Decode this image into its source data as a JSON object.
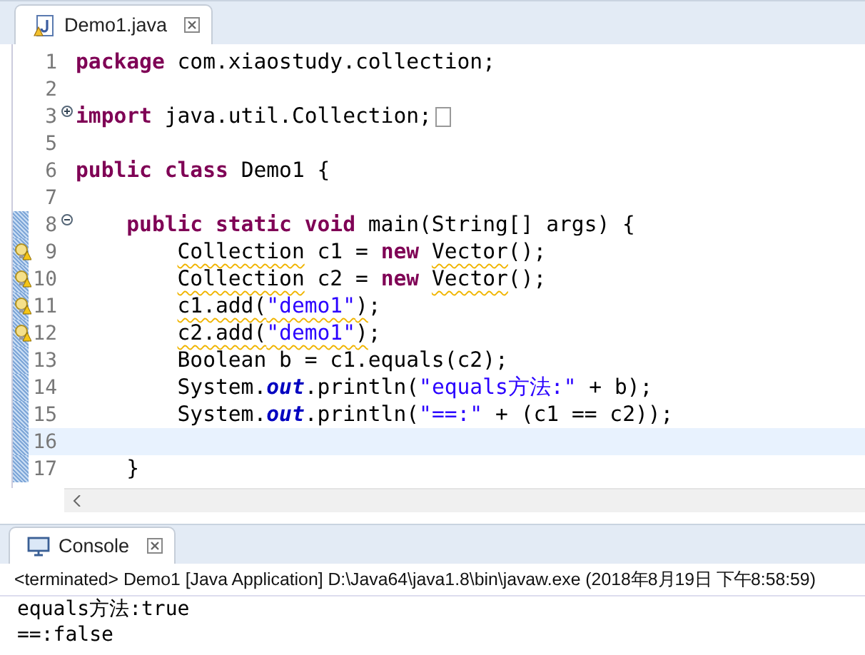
{
  "editor_tab": {
    "title": "Demo1.java",
    "selected": true
  },
  "editor": {
    "lines": [
      {
        "number": "1",
        "tokens": [
          {
            "kind": "keyword",
            "text": "package"
          },
          {
            "kind": "plain",
            "text": " com.xiaostudy.collection;"
          }
        ]
      },
      {
        "number": "2"
      },
      {
        "number": "3",
        "fold_collapsed": true,
        "collapsed_marker": true,
        "tokens": [
          {
            "kind": "keyword",
            "text": "import"
          },
          {
            "kind": "plain",
            "text": " java.util.Collection;"
          }
        ]
      },
      {
        "number": "5"
      },
      {
        "number": "6",
        "tokens": [
          {
            "kind": "keyword",
            "text": "public class"
          },
          {
            "kind": "plain",
            "text": " Demo1 {"
          }
        ],
        "children": [
          {
            "number": "7"
          },
          {
            "number": "8",
            "fold_expanded": true,
            "changed": true,
            "tokens": [
              {
                "kind": "keyword",
                "text": "public static void"
              },
              {
                "kind": "plain",
                "text": " main(String[] args) {"
              }
            ],
            "children": [
              {
                "number": "9",
                "warning": true,
                "changed": true,
                "tokens": [
                  {
                    "kind": "plain",
                    "text": "Collection",
                    "warning": true
                  },
                  {
                    "kind": "plain",
                    "text": " c1 = "
                  },
                  {
                    "kind": "keyword",
                    "text": "new"
                  },
                  {
                    "kind": "space"
                  },
                  {
                    "kind": "plain",
                    "text": "Vector",
                    "warning": true
                  },
                  {
                    "kind": "plain",
                    "text": "();"
                  }
                ]
              },
              {
                "number": "10",
                "warning": true,
                "changed": true,
                "tokens": [
                  {
                    "kind": "plain",
                    "text": "Collection",
                    "warning": true
                  },
                  {
                    "kind": "plain",
                    "text": " c2 = "
                  },
                  {
                    "kind": "keyword",
                    "text": "new"
                  },
                  {
                    "kind": "space"
                  },
                  {
                    "kind": "plain",
                    "text": "Vector",
                    "warning": true
                  },
                  {
                    "kind": "plain",
                    "text": "();"
                  }
                ]
              },
              {
                "number": "11",
                "warning": true,
                "changed": true,
                "tokens": [
                  {
                    "kind": "plain",
                    "text": "c1.add(",
                    "warning": true
                  },
                  {
                    "kind": "string",
                    "text": "\"demo1\"",
                    "warning": true
                  },
                  {
                    "kind": "plain",
                    "text": ")",
                    "warning": true
                  },
                  {
                    "kind": "plain",
                    "text": ";"
                  }
                ]
              },
              {
                "number": "12",
                "warning": true,
                "changed": true,
                "tokens": [
                  {
                    "kind": "plain",
                    "text": "c2.add(",
                    "warning": true
                  },
                  {
                    "kind": "string",
                    "text": "\"demo1\"",
                    "warning": true
                  },
                  {
                    "kind": "plain",
                    "text": ")",
                    "warning": true
                  },
                  {
                    "kind": "plain",
                    "text": ";"
                  }
                ]
              },
              {
                "number": "13",
                "changed": true,
                "tokens": [
                  {
                    "kind": "plain",
                    "text": "Boolean b = c1.equals(c2);"
                  }
                ]
              },
              {
                "number": "14",
                "changed": true,
                "tokens": [
                  {
                    "kind": "plain",
                    "text": "System."
                  },
                  {
                    "kind": "field",
                    "text": "out"
                  },
                  {
                    "kind": "plain",
                    "text": ".println("
                  },
                  {
                    "kind": "string",
                    "text": "\"equals方法:\""
                  },
                  {
                    "kind": "plain",
                    "text": " + b);"
                  }
                ]
              },
              {
                "number": "15",
                "changed": true,
                "tokens": [
                  {
                    "kind": "plain",
                    "text": "System."
                  },
                  {
                    "kind": "field",
                    "text": "out"
                  },
                  {
                    "kind": "plain",
                    "text": ".println("
                  },
                  {
                    "kind": "string",
                    "text": "\"==:\""
                  },
                  {
                    "kind": "plain",
                    "text": " + (c1 == c2));"
                  }
                ]
              },
              {
                "number": "16",
                "changed": true,
                "current": true
              }
            ]
          },
          {
            "number": "17",
            "changed": true,
            "tokens": [
              {
                "kind": "plain",
                "text": "}"
              }
            ]
          }
        ]
      }
    ]
  },
  "console_tab": {
    "title": "Console",
    "selected": true
  },
  "console": {
    "status": "<terminated> Demo1 [Java Application] D:\\Java64\\java1.8\\bin\\javaw.exe (2018年8月19日 下午8:58:59)",
    "output": [
      "equals方法:true",
      "==:false"
    ]
  }
}
